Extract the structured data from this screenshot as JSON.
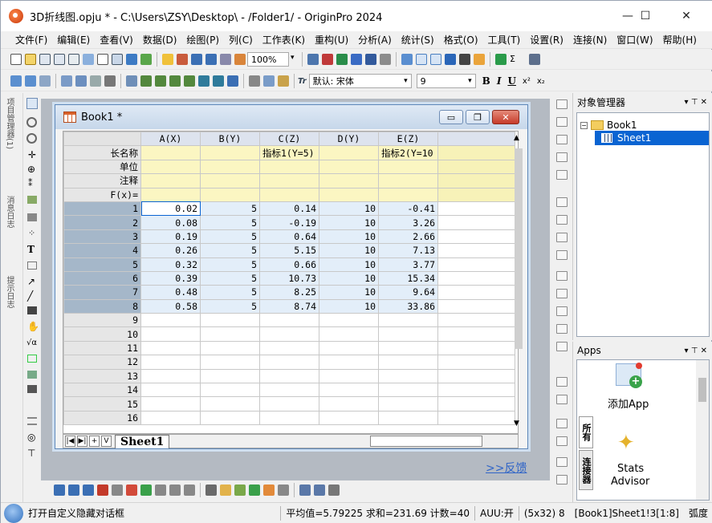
{
  "window": {
    "title": "3D折线图.opju * - C:\\Users\\ZSY\\Desktop\\ - /Folder1/ - OriginPro 2024",
    "min": "—",
    "max": "☐",
    "close": "✕"
  },
  "menu": [
    "文件(F)",
    "编辑(E)",
    "查看(V)",
    "数据(D)",
    "绘图(P)",
    "列(C)",
    "工作表(K)",
    "重构(U)",
    "分析(A)",
    "统计(S)",
    "格式(O)",
    "工具(T)",
    "设置(R)",
    "连接(N)",
    "窗口(W)",
    "帮助(H)"
  ],
  "toolbar": {
    "zoom": "100%",
    "font_name": "默认: 宋体",
    "font_size": "9",
    "font_prefix": "Tr",
    "bold": "B",
    "italic": "I",
    "underline": "U",
    "superscript": "x²",
    "subscript": "x₂"
  },
  "left_panels": {
    "project": "项目管理器(1)",
    "message": "消息日志",
    "hint": "提示日志"
  },
  "book": {
    "title": "Book1 *",
    "min": "▭",
    "restore": "❐",
    "close": "✕",
    "columns": [
      "A(X)",
      "B(Y)",
      "C(Z)",
      "D(Y)",
      "E(Z)"
    ],
    "label_rows": [
      {
        "name": "长名称",
        "cells": [
          "",
          "",
          "指标1(Y=5)",
          "",
          "指标2(Y=10"
        ]
      },
      {
        "name": "单位",
        "cells": [
          "",
          "",
          "",
          "",
          ""
        ]
      },
      {
        "name": "注释",
        "cells": [
          "",
          "",
          "",
          "",
          ""
        ]
      },
      {
        "name": "F(x)=",
        "cells": [
          "",
          "",
          "",
          "",
          ""
        ]
      }
    ],
    "data_rows": [
      {
        "n": "1",
        "cells": [
          "0.02",
          "5",
          "0.14",
          "10",
          "-0.41"
        ]
      },
      {
        "n": "2",
        "cells": [
          "0.08",
          "5",
          "-0.19",
          "10",
          "3.26"
        ]
      },
      {
        "n": "3",
        "cells": [
          "0.19",
          "5",
          "0.64",
          "10",
          "2.66"
        ]
      },
      {
        "n": "4",
        "cells": [
          "0.26",
          "5",
          "5.15",
          "10",
          "7.13"
        ]
      },
      {
        "n": "5",
        "cells": [
          "0.32",
          "5",
          "0.66",
          "10",
          "3.77"
        ]
      },
      {
        "n": "6",
        "cells": [
          "0.39",
          "5",
          "10.73",
          "10",
          "15.34"
        ]
      },
      {
        "n": "7",
        "cells": [
          "0.48",
          "5",
          "8.25",
          "10",
          "9.64"
        ]
      },
      {
        "n": "8",
        "cells": [
          "0.58",
          "5",
          "8.74",
          "10",
          "33.86"
        ]
      }
    ],
    "empty_rows": [
      "9",
      "10",
      "11",
      "12",
      "13",
      "14",
      "15",
      "16"
    ],
    "sheet_tab": "Sheet1",
    "nav": [
      "|◀",
      "▶|",
      "+",
      "V"
    ]
  },
  "feedback_link": ">>反馈",
  "object_manager": {
    "title": "对象管理器",
    "pin": "▾ ⊤ ✕",
    "book": "Book1",
    "sheet": "Sheet1"
  },
  "apps": {
    "title": "Apps",
    "pin": "▾ ⊤ ✕",
    "add_app": "添加App",
    "stats_advisor_1": "Stats",
    "stats_advisor_2": "Advisor",
    "tab_all": "所有",
    "tab_connectors": "连接器"
  },
  "status": {
    "hint": "打开自定义隐藏对话框",
    "stats": "平均值=5.79225 求和=231.69 计数=40",
    "mode": "AUU:开",
    "dims": "(5x32) 8",
    "sheet_ref": "[Book1]Sheet1!3[1:8]",
    "angle": "弧度"
  },
  "colors": {
    "selection": "#0a64d2",
    "label_row": "#fbf6c2",
    "data_cell": "#e3eef9",
    "row_header_sel": "#a5b7c9",
    "workspace": "#b4bac2"
  }
}
